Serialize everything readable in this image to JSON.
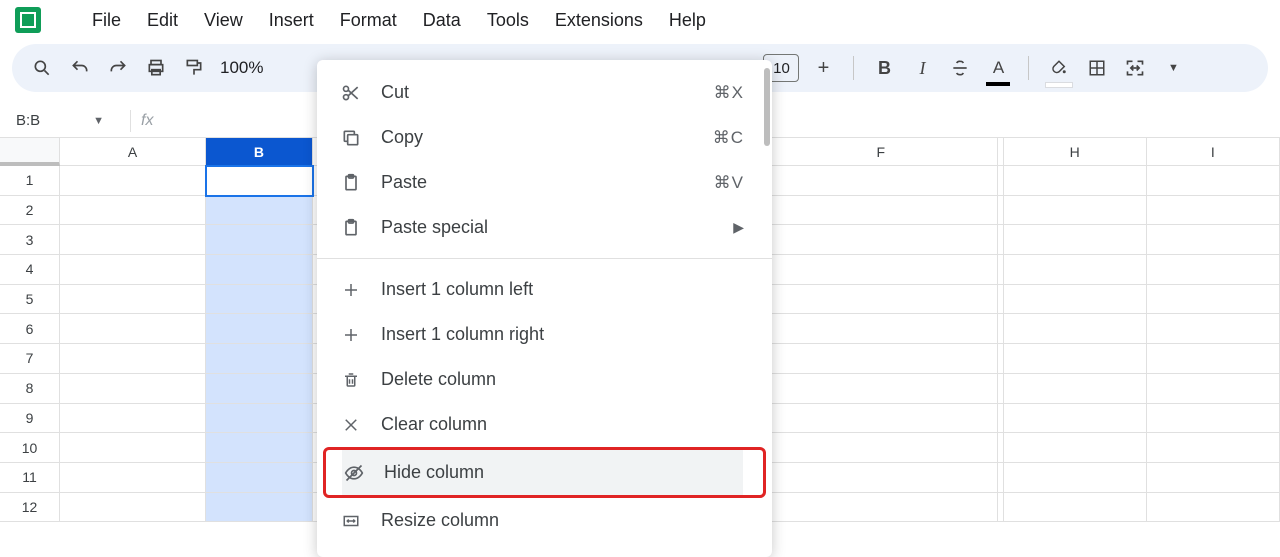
{
  "menus": {
    "file": "File",
    "edit": "Edit",
    "view": "View",
    "insert": "Insert",
    "format": "Format",
    "data": "Data",
    "tools": "Tools",
    "extensions": "Extensions",
    "help": "Help"
  },
  "toolbar": {
    "zoom": "100%",
    "font_size": "10"
  },
  "name_box": "B:B",
  "columns": {
    "A": "A",
    "B": "B",
    "F": "F",
    "H": "H",
    "I": "I"
  },
  "rows": [
    "1",
    "2",
    "3",
    "4",
    "5",
    "6",
    "7",
    "8",
    "9",
    "10",
    "11",
    "12"
  ],
  "context_menu": {
    "cut": {
      "label": "Cut",
      "accel": "⌘X"
    },
    "copy": {
      "label": "Copy",
      "accel": "⌘C"
    },
    "paste": {
      "label": "Paste",
      "accel": "⌘V"
    },
    "paste_special": {
      "label": "Paste special"
    },
    "insert_left": {
      "label": "Insert 1 column left"
    },
    "insert_right": {
      "label": "Insert 1 column right"
    },
    "delete_col": {
      "label": "Delete column"
    },
    "clear_col": {
      "label": "Clear column"
    },
    "hide_col": {
      "label": "Hide column"
    },
    "resize_col": {
      "label": "Resize column"
    }
  }
}
